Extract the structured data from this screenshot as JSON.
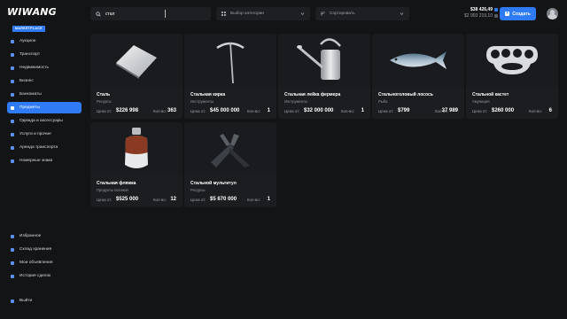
{
  "logo": {
    "title": "WIWANG",
    "subtitle": "MARKETPLACE"
  },
  "search": {
    "value": "стал"
  },
  "filters": {
    "category": "Выбор категории",
    "sort": "Сортировать"
  },
  "balance": {
    "primary": "$38 426,49",
    "secondary": "$2 903 219,10"
  },
  "create_label": "Создать",
  "sidebar": {
    "items": [
      {
        "label": "Аукцион",
        "active": false
      },
      {
        "label": "Транспорт",
        "active": false
      },
      {
        "label": "Недвижимость",
        "active": false
      },
      {
        "label": "Бизнес",
        "active": false
      },
      {
        "label": "Банкоматы",
        "active": false
      },
      {
        "label": "Предметы",
        "active": true
      },
      {
        "label": "Одежда и аксессуары",
        "active": false
      },
      {
        "label": "Услуги и прочие",
        "active": false
      },
      {
        "label": "Аренда транспорта",
        "active": false
      },
      {
        "label": "Номерные знаки",
        "active": false
      }
    ],
    "bottom": [
      {
        "label": "Избранное"
      },
      {
        "label": "Склад хранения"
      },
      {
        "label": "Мои объявления"
      },
      {
        "label": "История сделок"
      }
    ],
    "exit": "Выйти"
  },
  "labels": {
    "price": "Цена от:",
    "qty": "Кол-во:"
  },
  "products": [
    {
      "title": "Сталь",
      "category": "Ресурсы",
      "price": "$226 998",
      "qty": "363",
      "icon": "steel-plate-icon"
    },
    {
      "title": "Стальная кирка",
      "category": "Инструменты",
      "price": "$45 000 000",
      "qty": "1",
      "icon": "pickaxe-icon"
    },
    {
      "title": "Стальная лейка фермера",
      "category": "Инструменты",
      "price": "$32 000 000",
      "qty": "1",
      "icon": "watering-can-icon"
    },
    {
      "title": "Стальноголовый лосось",
      "category": "Рыба",
      "price": "$799",
      "qty": "37 989",
      "icon": "salmon-icon"
    },
    {
      "title": "Стальной кастет",
      "category": "Амуниция",
      "price": "$260 000",
      "qty": "6",
      "icon": "brass-knuckles-icon"
    },
    {
      "title": "Стальная фляжка",
      "category": "Продукты питания",
      "price": "$525 000",
      "qty": "12",
      "icon": "flask-icon"
    },
    {
      "title": "Стальной мультитул",
      "category": "Ресурсы",
      "price": "$5 670 000",
      "qty": "1",
      "icon": "multitool-icon"
    }
  ]
}
